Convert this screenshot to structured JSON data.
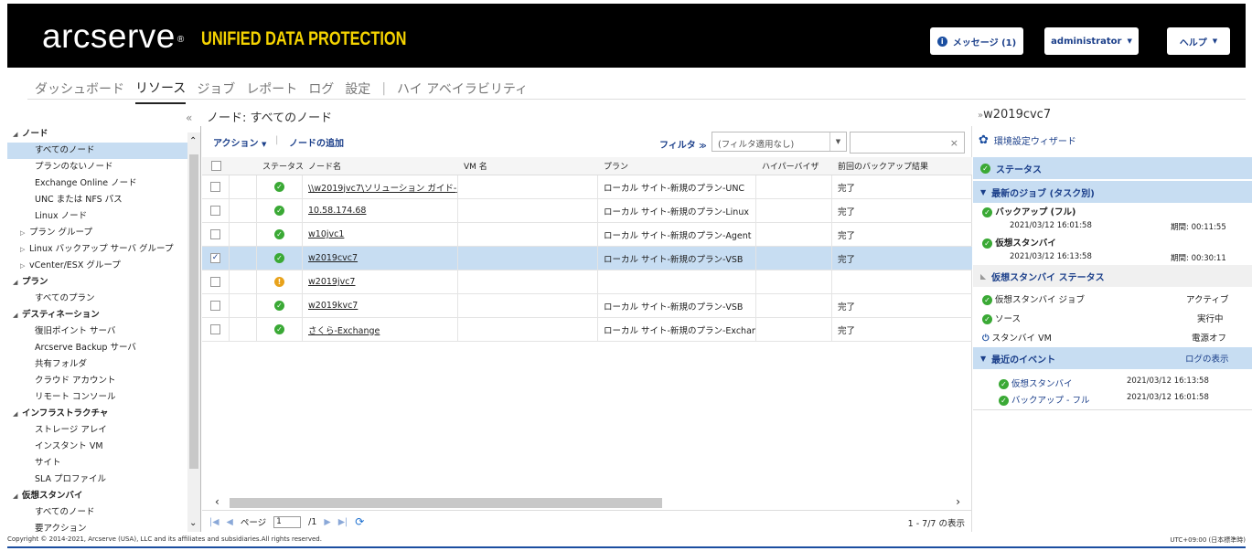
{
  "brand": {
    "logo": "arcserve",
    "reg": "®",
    "product": "UNIFIED DATA PROTECTION"
  },
  "topbar": {
    "messages": "メッセージ (1)",
    "user": "administrator",
    "help": "ヘルプ"
  },
  "nav": {
    "items": [
      "ダッシュボード",
      "リソース",
      "ジョブ",
      "レポート",
      "ログ",
      "設定",
      "|",
      "ハイ アベイラビリティ"
    ],
    "active": "リソース"
  },
  "breadcrumb": "ノード: すべてのノード",
  "sidebar": {
    "items": [
      {
        "label": "ノード",
        "level": 0
      },
      {
        "label": "すべてのノード",
        "level": 1,
        "selected": true
      },
      {
        "label": "プランのないノード",
        "level": 1
      },
      {
        "label": "Exchange Online ノード",
        "level": 1
      },
      {
        "label": "UNC または NFS パス",
        "level": 1
      },
      {
        "label": "Linux ノード",
        "level": 1
      },
      {
        "label": "プラン グループ",
        "level": 1,
        "collapsed": true
      },
      {
        "label": "Linux バックアップ サーバ グループ",
        "level": 1,
        "collapsed": true
      },
      {
        "label": "vCenter/ESX グループ",
        "level": 1,
        "collapsed": true
      },
      {
        "label": "プラン",
        "level": 0
      },
      {
        "label": "すべてのプラン",
        "level": 1
      },
      {
        "label": "デスティネーション",
        "level": 0
      },
      {
        "label": "復旧ポイント サーバ",
        "level": 1
      },
      {
        "label": "Arcserve Backup サーバ",
        "level": 1
      },
      {
        "label": "共有フォルダ",
        "level": 1
      },
      {
        "label": "クラウド アカウント",
        "level": 1
      },
      {
        "label": "リモート コンソール",
        "level": 1
      },
      {
        "label": "インフラストラクチャ",
        "level": 0
      },
      {
        "label": "ストレージ アレイ",
        "level": 1
      },
      {
        "label": "インスタント VM",
        "level": 1
      },
      {
        "label": "サイト",
        "level": 1
      },
      {
        "label": "SLA プロファイル",
        "level": 1
      },
      {
        "label": "仮想スタンバイ",
        "level": 0
      },
      {
        "label": "すべてのノード",
        "level": 1
      },
      {
        "label": "要アクション",
        "level": 1
      }
    ]
  },
  "toolbar": {
    "action": "アクション",
    "add_node": "ノードの追加",
    "filter": "フィルタ",
    "filter_value": "(フィルタ適用なし)"
  },
  "table": {
    "headers": [
      "ステータス",
      "ノード名",
      "VM 名",
      "プラン",
      "ハイパーバイザ",
      "前回のバックアップ結果"
    ],
    "rows": [
      {
        "status": "ok",
        "node": "\\\\w2019jvc7\\ソリューション ガイド-JPN",
        "vm": "",
        "plan": "ローカル サイト-新規のプラン-UNC",
        "hv": "",
        "result": "完了",
        "checked": false
      },
      {
        "status": "ok",
        "node": "10.58.174.68",
        "vm": "",
        "plan": "ローカル サイト-新規のプラン-Linux",
        "hv": "",
        "result": "完了",
        "checked": false
      },
      {
        "status": "ok",
        "node": "w10jvc1",
        "vm": "",
        "plan": "ローカル サイト-新規のプラン-Agent",
        "hv": "",
        "result": "完了",
        "checked": false
      },
      {
        "status": "ok",
        "node": "w2019cvc7",
        "vm": "",
        "plan": "ローカル サイト-新規のプラン-VSB",
        "hv": "",
        "result": "完了",
        "checked": true
      },
      {
        "status": "warn",
        "node": "w2019jvc7",
        "vm": "",
        "plan": "",
        "hv": "",
        "result": "",
        "checked": false
      },
      {
        "status": "ok",
        "node": "w2019kvc7",
        "vm": "",
        "plan": "ローカル サイト-新規のプラン-VSB",
        "hv": "",
        "result": "完了",
        "checked": false
      },
      {
        "status": "ok",
        "node": "さくら-Exchange",
        "vm": "",
        "plan": "ローカル サイト-新規のプラン-Exchange",
        "hv": "",
        "result": "完了",
        "checked": false
      }
    ]
  },
  "pager": {
    "page_label": "ページ",
    "page": "1",
    "of": "/1",
    "count": "1 - 7/7 の表示"
  },
  "right": {
    "title": "w2019cvc7",
    "wizard": "環境設定ウィザード",
    "status": "ステータス",
    "latest_jobs": "最新のジョブ (タスク別)",
    "job1": {
      "name": "バックアップ (フル)",
      "date": "2021/03/12 16:01:58",
      "period": "期間: 00:11:55"
    },
    "job2": {
      "name": "仮想スタンバイ",
      "date": "2021/03/12 16:13:58",
      "period": "期間: 00:30:11"
    },
    "vsb_status": "仮想スタンバイ ステータス",
    "vsb": [
      {
        "label": "仮想スタンバイ ジョブ",
        "value": "アクティブ"
      },
      {
        "label": "ソース",
        "value": "実行中"
      },
      {
        "label": "スタンバイ VM",
        "value": "電源オフ"
      }
    ],
    "recent_events": "最近のイベント",
    "log_view": "ログの表示",
    "events": [
      {
        "label": "仮想スタンバイ",
        "date": "2021/03/12 16:13:58"
      },
      {
        "label": "バックアップ - フル",
        "date": "2021/03/12 16:01:58"
      }
    ]
  },
  "footer": {
    "copyright": "Copyright © 2014-2021, Arcserve (USA), LLC and its affiliates and subsidiaries.All rights reserved.",
    "timezone": "UTC+09:00 (日本標準時)"
  }
}
